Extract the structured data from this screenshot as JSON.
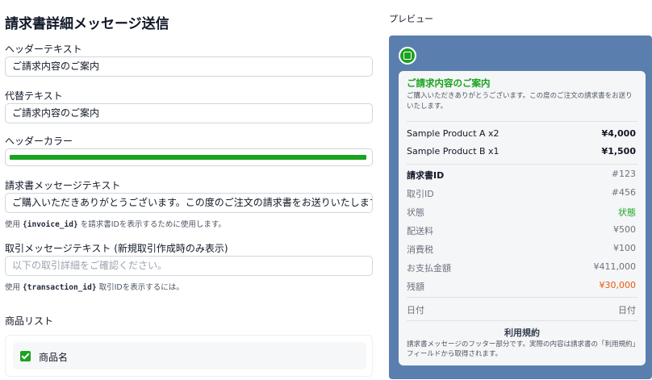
{
  "page_title": "請求書詳細メッセージ送信",
  "form": {
    "header_text": {
      "label": "ヘッダーテキスト",
      "value": "ご請求内容のご案内"
    },
    "alt_text": {
      "label": "代替テキスト",
      "value": "ご請求内容のご案内"
    },
    "header_color": {
      "label": "ヘッダーカラー",
      "value": "#1aa31f"
    },
    "invoice_message": {
      "label": "請求書メッセージテキスト",
      "value": "ご購入いただきありがとうございます。この度のご注文の請求書をお送りいたします。",
      "hint_prefix": "使用",
      "hint_code": "{invoice_id}",
      "hint_suffix": "を請求書IDを表示するために使用します。"
    },
    "transaction_message": {
      "label": "取引メッセージテキスト (新規取引作成時のみ表示)",
      "placeholder": "以下の取引詳細をご確認ください。",
      "hint_prefix": "使用",
      "hint_code": "{transaction_id}",
      "hint_suffix": "取引IDを表示するには。"
    },
    "product_list": {
      "label": "商品リスト",
      "items": [
        {
          "name": "商品名",
          "checked": true
        }
      ]
    }
  },
  "preview": {
    "label": "プレビュー",
    "header": "ご請求内容のご案内",
    "intro": "ご購入いただきありがとうございます。この度のご注文の請求書をお送りいたします。",
    "products": [
      {
        "name": "Sample Product A x2",
        "price": "¥4,000"
      },
      {
        "name": "Sample Product B x1",
        "price": "¥1,500"
      }
    ],
    "invoice_id": {
      "label": "請求書ID",
      "value": "#123"
    },
    "transaction_id": {
      "label": "取引ID",
      "value": "#456"
    },
    "status": {
      "label": "状態",
      "value": "状態"
    },
    "shipping": {
      "label": "配送料",
      "value": "¥500"
    },
    "tax": {
      "label": "消費税",
      "value": "¥100"
    },
    "paid": {
      "label": "お支払金額",
      "value": "¥411,000"
    },
    "remaining": {
      "label": "残額",
      "value": "¥30,000"
    },
    "date": {
      "label": "日付",
      "value": "日付"
    },
    "terms_title": "利用規約",
    "terms_text": "請求書メッセージのフッター部分です。実際の内容は請求書の「利用規約」フィールドから取得されます。"
  },
  "colors": {
    "accent": "#1aa31f",
    "preview_background": "#5a7fae",
    "remaining_amount": "#ea580c"
  }
}
